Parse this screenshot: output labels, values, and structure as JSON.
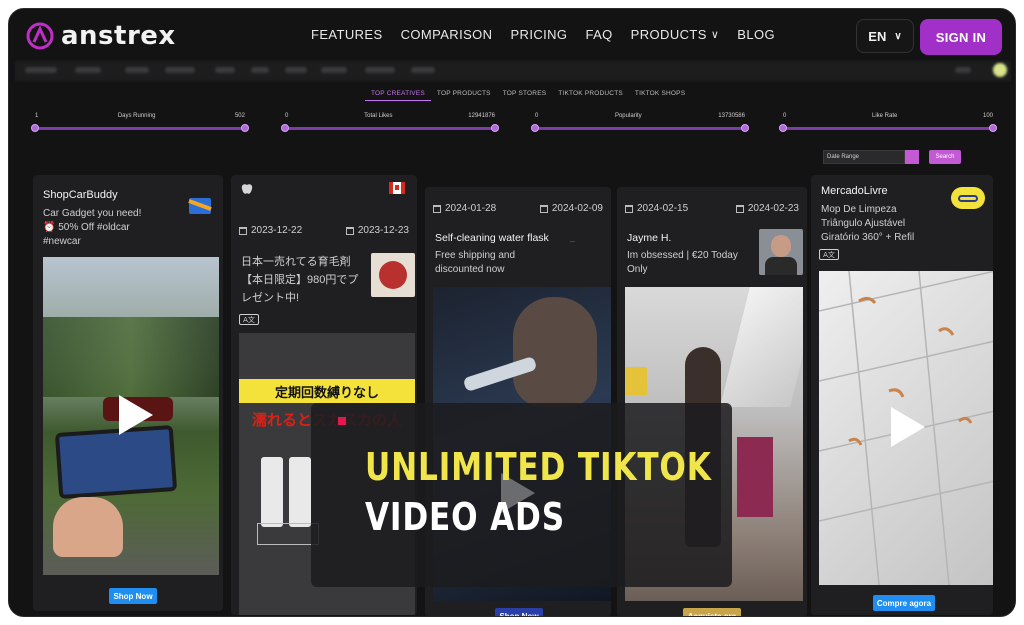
{
  "nav": {
    "logo": "anstrex",
    "links": [
      "FEATURES",
      "COMPARISON",
      "PRICING",
      "FAQ",
      "PRODUCTS",
      "BLOG"
    ],
    "language": "EN",
    "sign_in": "SIGN IN"
  },
  "tabs": [
    "TOP CREATIVES",
    "TOP PRODUCTS",
    "TOP STORES",
    "TIKTOK PRODUCTS",
    "TIKTOK SHOPS"
  ],
  "filters": [
    {
      "min": "1",
      "label": "Days Running",
      "max": "502"
    },
    {
      "min": "0",
      "label": "Total Likes",
      "max": "12941876"
    },
    {
      "min": "0",
      "label": "Popularity",
      "max": "13730586"
    },
    {
      "min": "0",
      "label": "Like Rate",
      "max": "100"
    }
  ],
  "date_range_placeholder": "Date Range",
  "search_label": "Search",
  "cards": [
    {
      "name": "ShopCarBuddy",
      "desc_lines": [
        "Car Gadget you need!",
        "⏰ 50% Off #oldcar",
        "#newcar"
      ],
      "cta": "Shop Now"
    },
    {
      "start": "2023-12-22",
      "end": "2023-12-23",
      "desc_lines": [
        "日本一売れてる育毛剤",
        "【本日限定】980円でプ",
        "レゼント中!"
      ],
      "ad_top": "定期回数縛りなし",
      "ad_mid": "濡れるとスカスカの人"
    },
    {
      "start": "2024-01-28",
      "end": "2024-02-09",
      "title": "Self-cleaning water flask",
      "desc_lines": [
        "Free shipping and",
        "discounted now"
      ],
      "cta": "Shop Now"
    },
    {
      "start": "2024-02-15",
      "end": "2024-02-23",
      "title": "Jayme H.",
      "desc_lines": [
        "Im obsessed | €20 Today",
        "Only"
      ],
      "cta": "Acquista ora"
    },
    {
      "name": "MercadoLivre",
      "desc_lines": [
        "Mop De Limpeza",
        "Triângulo Ajustável",
        "Giratório 360° + Refil"
      ],
      "cta": "Compre agora"
    }
  ],
  "banner": {
    "line1": "UNLIMITED TIKTOK",
    "line2": "VIDEO ADS"
  },
  "colors": {
    "accent": "#a030c8",
    "banner_yellow": "#f0e64b",
    "cta_blue": "#1f8ef0"
  }
}
